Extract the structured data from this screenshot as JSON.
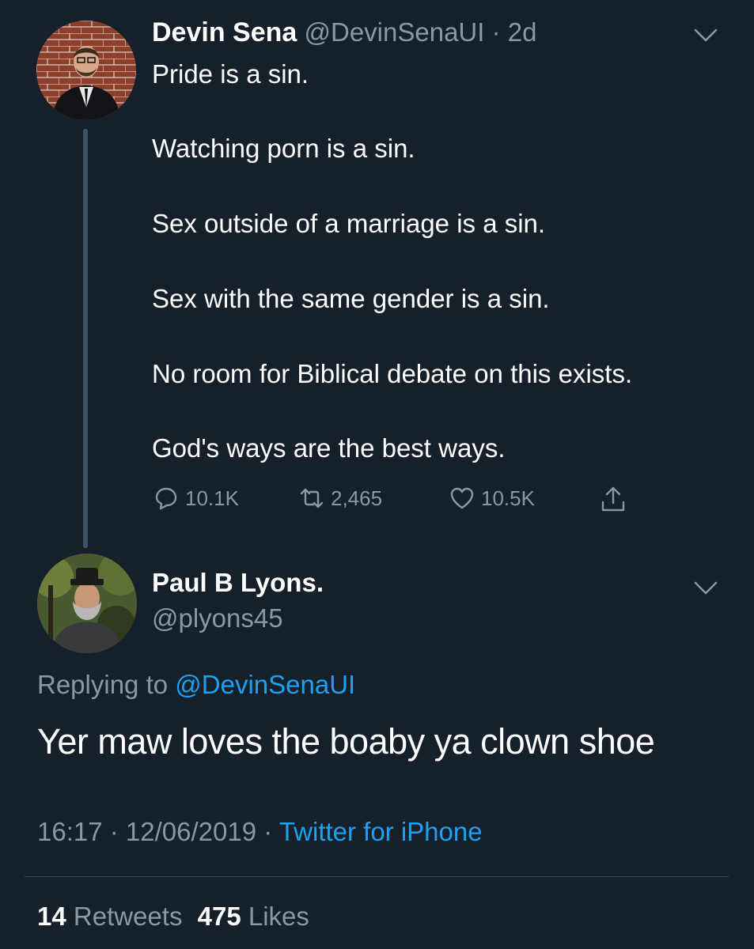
{
  "parent_tweet": {
    "display_name": "Devin Sena",
    "handle_time": "@DevinSenaUI · 2d",
    "lines": [
      "Pride is a sin.",
      "Watching porn is a sin.",
      "Sex outside of a marriage is a sin.",
      "Sex with the same gender is a sin.",
      "No room for Biblical debate on this exists.",
      "God's ways are the best ways."
    ],
    "replies": "10.1K",
    "retweets": "2,465",
    "likes": "10.5K"
  },
  "reply_tweet": {
    "display_name": "Paul B Lyons.",
    "handle": "@plyons45",
    "replying_prefix": "Replying to",
    "replying_to": "@DevinSenaUI",
    "text": "Yer maw loves the boaby ya clown shoe",
    "time_date": "16:17 · 12/06/2019 ·",
    "source": "Twitter for iPhone",
    "retweets_count": "14",
    "retweets_label": "Retweets",
    "likes_count": "475",
    "likes_label": "Likes"
  },
  "icons": [
    "chevron-down-icon",
    "reply-icon",
    "retweet-icon",
    "like-icon",
    "share-icon"
  ],
  "colors": {
    "background": "#15202b",
    "muted": "#8899a6",
    "accent": "#1da1f2",
    "divider": "#38444d"
  }
}
